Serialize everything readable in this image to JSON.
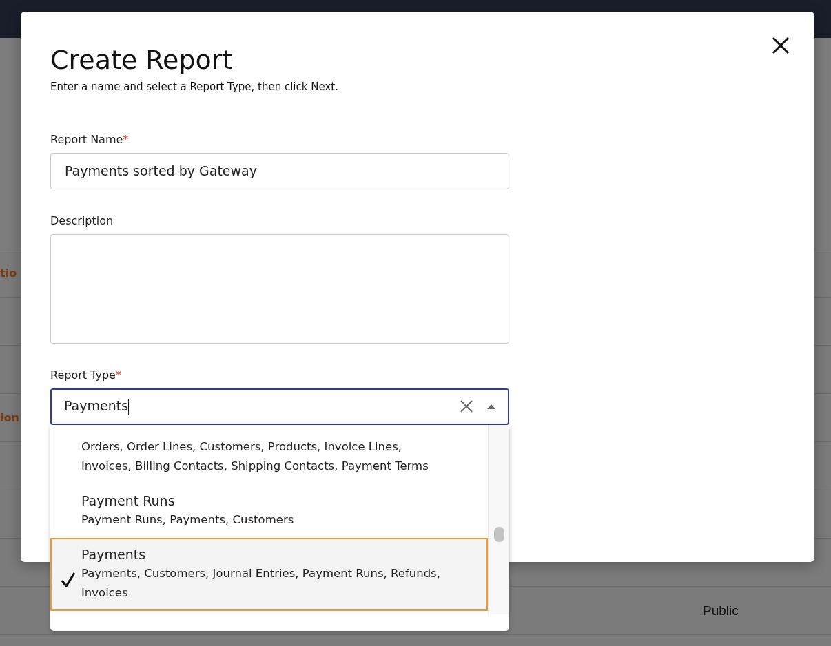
{
  "background": {
    "rows": [
      {
        "cell": "tio"
      },
      {
        "cell": "ion"
      },
      {
        "cell": "Public"
      }
    ]
  },
  "dialog": {
    "title": "Create Report",
    "subtitle": "Enter a name and select a Report Type, then click Next.",
    "fields": [
      {
        "kind": "text",
        "label": "Report Name",
        "required_mark": "*",
        "value": "Payments sorted by Gateway"
      },
      {
        "kind": "textarea",
        "label": "Description"
      },
      {
        "kind": "combobox",
        "label": "Report Type",
        "required_mark": "*",
        "value": "Payments",
        "expanded": true
      }
    ],
    "options": [
      {
        "description": "Orders, Order Lines, Customers, Products, Invoice Lines, Invoices, Billing Contacts, Shipping Contacts, Payment Terms",
        "selected": false
      },
      {
        "title": "Payment Runs",
        "description": "Payment Runs, Payments, Customers",
        "selected": false
      },
      {
        "title": "Payments",
        "description": "Payments, Customers, Journal Entries, Payment Runs, Refunds, Invoices",
        "selected": true
      }
    ]
  }
}
